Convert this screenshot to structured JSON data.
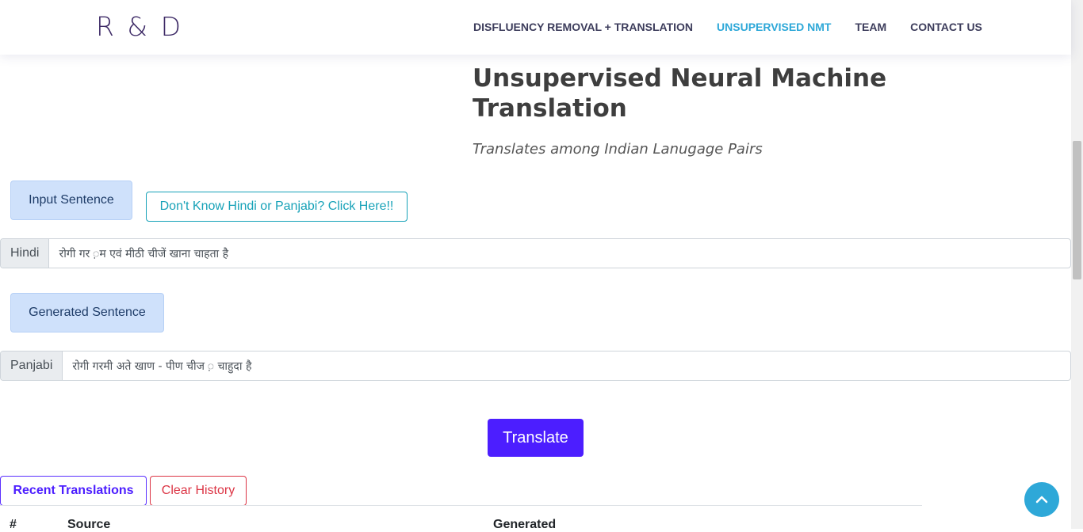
{
  "header": {
    "logo": "R & D",
    "nav": [
      {
        "label": "DISFLUENCY REMOVAL + TRANSLATION",
        "active": false
      },
      {
        "label": "UNSUPERVISED NMT",
        "active": true
      },
      {
        "label": "TEAM",
        "active": false
      },
      {
        "label": "CONTACT US",
        "active": false
      }
    ]
  },
  "hero": {
    "title": "Unsupervised Neural Machine Translation",
    "subtitle": "Translates among Indian Lanugage Pairs"
  },
  "input": {
    "label": "Input Sentence",
    "help_button": "Don't Know Hindi or Panjabi? Click Here!!",
    "language": "Hindi",
    "value": "रोगी गर ़म एवं मीठी चीजें खाना चाहता है"
  },
  "output": {
    "label": "Generated Sentence",
    "language": "Panjabi",
    "value": "रोगी गरमी अते खाण - पीण चीज ़ चाहुदा है"
  },
  "actions": {
    "translate": "Translate"
  },
  "history": {
    "recent_label": "Recent Translations",
    "clear_label": "Clear History",
    "columns": [
      "#",
      "Source",
      "Generated"
    ]
  },
  "colors": {
    "accent": "#4c1eff",
    "link_active": "#2ea8d8",
    "info": "#17a2b8",
    "danger": "#dc3545"
  },
  "icons": {
    "back_to_top": "chevron-up-icon"
  }
}
